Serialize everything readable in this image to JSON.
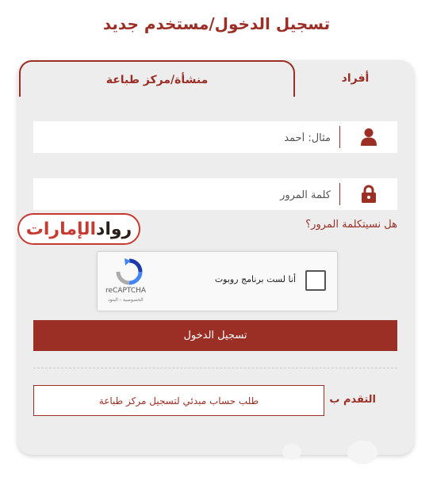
{
  "header": {
    "title": "تسجيل الدخول/مستخدم جديد"
  },
  "tabs": {
    "organization": "منشأة/مركز طباعة",
    "individuals": "أفراد"
  },
  "form": {
    "username_placeholder": "مثال: أحمد",
    "password_placeholder": "كلمة المرور",
    "forgot_password": "هل نسيتكلمة المرور؟",
    "login_button": "تسجيل الدخول"
  },
  "captcha": {
    "label": "أنا لست برنامج روبوت",
    "brand": "reCAPTCHA",
    "links": "الخصوصية - البنود"
  },
  "logo": {
    "text_part1": "رواد",
    "text_part2": "الإمارات"
  },
  "apply": {
    "label": "التقدم ب",
    "button": "طلب حساب مبدئي لتسجيل مركز طباعة"
  },
  "colors": {
    "accent": "#9b2e25",
    "card_bg": "#ededed",
    "logo_red": "#c63a32"
  },
  "icons": {
    "user": "user-icon",
    "password": "lock-icon",
    "captcha": "recaptcha-icon"
  }
}
